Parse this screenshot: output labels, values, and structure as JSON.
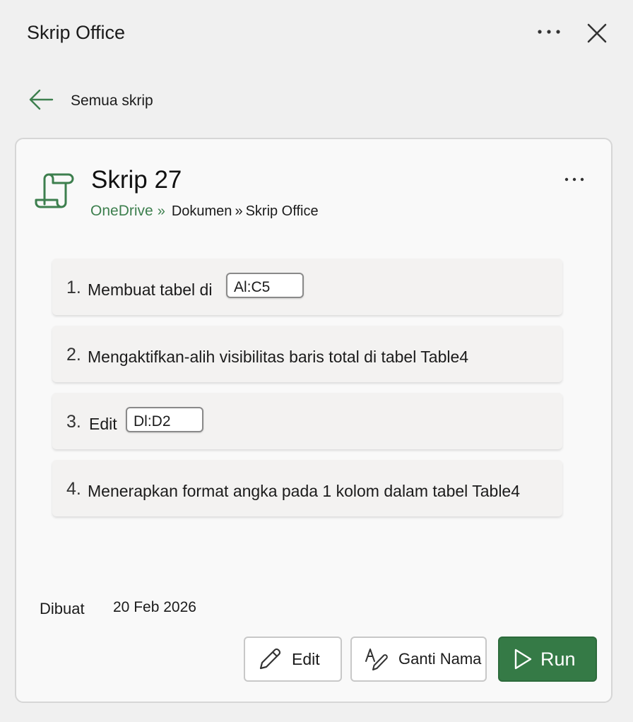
{
  "pane": {
    "title": "Skrip Office",
    "more_icon": "more-horizontal-icon",
    "close_icon": "close-icon"
  },
  "nav": {
    "back_label": "Semua skrip",
    "back_icon": "arrow-left-icon"
  },
  "script": {
    "icon": "script-scroll-icon",
    "title": "Skrip 27",
    "breadcrumb": {
      "root": "OneDrive",
      "root_sep": "»",
      "folder": "Dokumen",
      "sep": "»",
      "subfolder": "Skrip Office"
    },
    "steps": [
      {
        "number": "1.",
        "text": "Membuat tabel di",
        "range": "Al:C5"
      },
      {
        "number": "2.",
        "text": "Mengaktifkan-alih visibilitas baris total di tabel Table4"
      },
      {
        "number": "3.",
        "text": "Edit",
        "range": "Dl:D2"
      },
      {
        "number": "4.",
        "text": "Menerapkan format angka pada 1 kolom dalam tabel Table4"
      }
    ],
    "created_label": "Dibuat",
    "created_value": "20 Feb 2026"
  },
  "actions": {
    "edit_label": "Edit",
    "edit_icon": "pencil-icon",
    "rename_label": "Ganti Nama",
    "rename_icon": "rename-icon",
    "run_label": "Run",
    "run_icon": "play-icon"
  },
  "colors": {
    "accent_green": "#3d7f4e",
    "run_button": "#357a46",
    "pane_background": "#f0f0f0",
    "card_background": "#f9f9f9"
  }
}
